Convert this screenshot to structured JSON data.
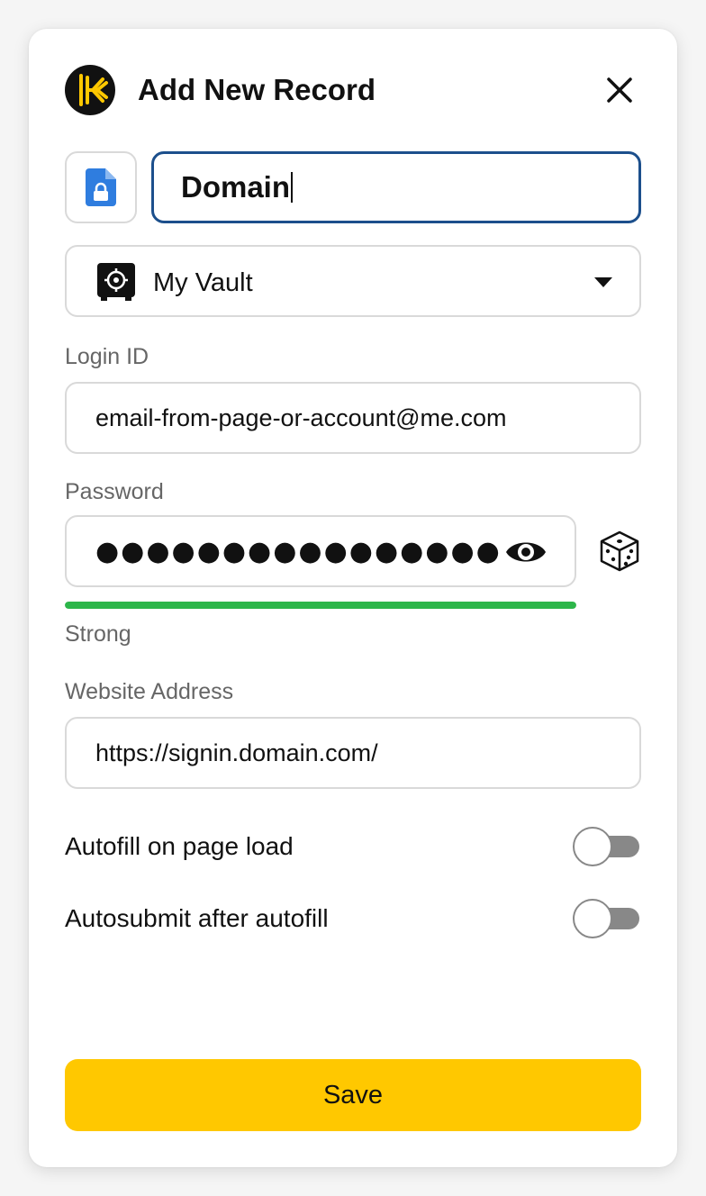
{
  "header": {
    "title": "Add New Record",
    "logo_icon": "keeper-logo-icon",
    "close_icon": "close-icon"
  },
  "record": {
    "type_icon": "locked-document-icon",
    "title_value": "Domain",
    "focused": true
  },
  "vault": {
    "icon": "safe-icon",
    "selected": "My Vault"
  },
  "login": {
    "label": "Login ID",
    "value": "email-from-page-or-account@me.com"
  },
  "password": {
    "label": "Password",
    "masked_value": "●●●●●●●●●●●●●●●●",
    "show_icon": "eye-icon",
    "generate_icon": "dice-icon",
    "strength": "Strong",
    "strength_fraction": 1.0,
    "strength_color": "#2db64a"
  },
  "website": {
    "label": "Website Address",
    "value": "https://signin.domain.com/"
  },
  "toggles": [
    {
      "label": "Autofill on page load",
      "on": false
    },
    {
      "label": "Autosubmit after autofill",
      "on": false
    }
  ],
  "save_label": "Save",
  "colors": {
    "accent": "#ffc800",
    "focus_border": "#1c4f8c",
    "file_icon_blue": "#2f7ddf"
  }
}
